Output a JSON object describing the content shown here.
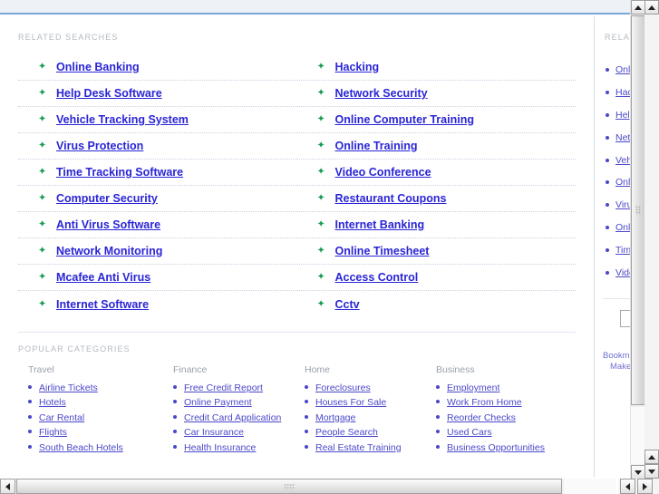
{
  "sections": {
    "related_searches_label": "RELATED SEARCHES",
    "popular_categories_label": "POPULAR CATEGORIES",
    "sidebar_label": "RELATED"
  },
  "related_searches": {
    "left_column": [
      "Online Banking",
      "Help Desk Software",
      "Vehicle Tracking System",
      "Virus Protection",
      "Time Tracking Software",
      "Computer Security",
      "Anti Virus Software",
      "Network Monitoring",
      "Mcafee Anti Virus",
      "Internet Software"
    ],
    "right_column": [
      "Hacking",
      "Network Security",
      "Online Computer Training",
      "Online Training",
      "Video Conference",
      "Restaurant Coupons",
      "Internet Banking",
      "Online Timesheet",
      "Access Control",
      "Cctv"
    ]
  },
  "popular_categories": [
    {
      "title": "Travel",
      "items": [
        "Airline Tickets",
        "Hotels",
        "Car Rental",
        "Flights",
        "South Beach Hotels"
      ]
    },
    {
      "title": "Finance",
      "items": [
        "Free Credit Report",
        "Online Payment",
        "Credit Card Application",
        "Car Insurance",
        "Health Insurance"
      ]
    },
    {
      "title": "Home",
      "items": [
        "Foreclosures",
        "Houses For Sale",
        "Mortgage",
        "People Search",
        "Real Estate Training"
      ]
    },
    {
      "title": "Business",
      "items": [
        "Employment",
        "Work From Home",
        "Reorder Checks",
        "Used Cars",
        "Business Opportunities"
      ]
    }
  ],
  "sidebar": {
    "links": [
      "Online Banking",
      "Hacking",
      "Help Desk Software",
      "Network Security",
      "Vehicle Tracking System",
      "Online Computer Training",
      "Virus Protection",
      "Online Training",
      "Time Tracking Software",
      "Video Conference"
    ],
    "input_value": "",
    "input_placeholder": "",
    "footer_line1": "Bookmark",
    "footer_line2": "Make this"
  },
  "colors": {
    "link_blue": "#2a25d6",
    "sidebar_link": "#4b48c9",
    "bullet_green": "#1a9c54",
    "bullet_purple": "#4a47c8",
    "label_gray": "#b4b9c2",
    "top_strip": "#eef2f7",
    "top_border": "#7ba7d7"
  },
  "icons": {
    "arrow_bullet": "sparkle-arrow-icon",
    "dot_bullet": "dot-bullet-icon",
    "scroll_up": "scroll-up-arrow-icon",
    "scroll_down": "scroll-down-arrow-icon",
    "scroll_left": "scroll-left-arrow-icon",
    "scroll_right": "scroll-right-arrow-icon"
  }
}
